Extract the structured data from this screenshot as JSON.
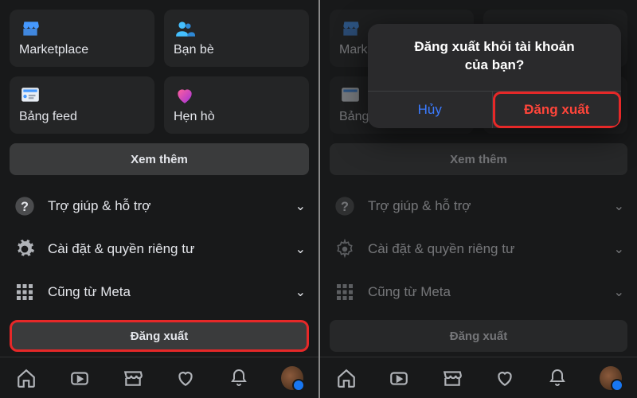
{
  "tiles": {
    "marketplace": "Marketplace",
    "friends": "Bạn bè",
    "feeds": "Bảng feed",
    "dating": "Hẹn hò"
  },
  "see_more": "Xem thêm",
  "rows": {
    "help": "Trợ giúp & hỗ trợ",
    "settings": "Cài đặt & quyền riêng tư",
    "meta": "Cũng từ Meta"
  },
  "logout": "Đăng xuất",
  "dialog": {
    "line1": "Đăng xuất khỏi tài khoản",
    "line2": "của bạn?",
    "cancel": "Hủy",
    "confirm": "Đăng xuất"
  }
}
